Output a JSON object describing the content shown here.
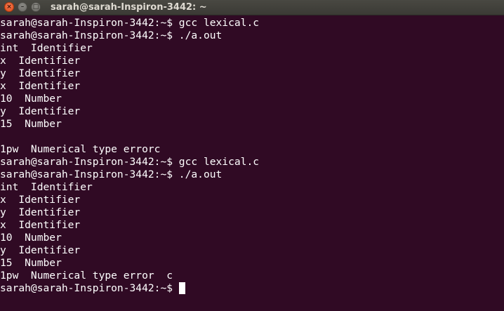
{
  "window": {
    "title": "sarah@sarah-Inspiron-3442: ~",
    "close_glyph": "×",
    "minimize_glyph": "–",
    "maximize_glyph": "□"
  },
  "colors": {
    "terminal_background": "#300a24",
    "terminal_foreground": "#ffffff",
    "titlebar": "#3c3b37",
    "close_button": "#e95420"
  },
  "terminal": {
    "lines": [
      "sarah@sarah-Inspiron-3442:~$ gcc lexical.c",
      "sarah@sarah-Inspiron-3442:~$ ./a.out",
      "int  Identifier",
      "x  Identifier",
      "y  Identifier",
      "x  Identifier",
      "10  Number",
      "y  Identifier",
      "15  Number",
      "",
      "1pw  Numerical type errorc",
      "sarah@sarah-Inspiron-3442:~$ gcc lexical.c",
      "sarah@sarah-Inspiron-3442:~$ ./a.out",
      "int  Identifier",
      "x  Identifier",
      "y  Identifier",
      "x  Identifier",
      "10  Number",
      "y  Identifier",
      "15  Number",
      "1pw  Numerical type error  c"
    ],
    "prompt": "sarah@sarah-Inspiron-3442:~$ "
  }
}
